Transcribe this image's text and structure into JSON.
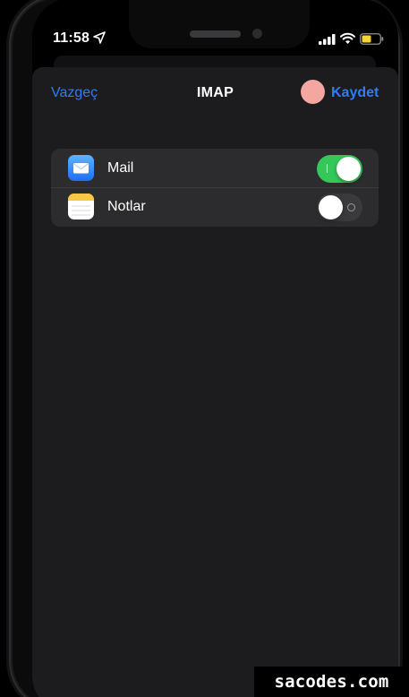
{
  "status_bar": {
    "time": "11:58",
    "location_icon": "location-arrow-icon",
    "signal_icon": "cellular-signal-icon",
    "wifi_icon": "wifi-icon",
    "battery_icon": "battery-low-icon",
    "battery_color": "#f5d33b"
  },
  "nav": {
    "cancel_label": "Vazgeç",
    "title": "IMAP",
    "save_label": "Kaydet",
    "accent_color": "#2f7cf6"
  },
  "services": [
    {
      "label": "Mail",
      "icon": "mail-app-icon",
      "enabled": true
    },
    {
      "label": "Notlar",
      "icon": "notes-app-icon",
      "enabled": false
    }
  ],
  "watermark": "sacodes.com"
}
